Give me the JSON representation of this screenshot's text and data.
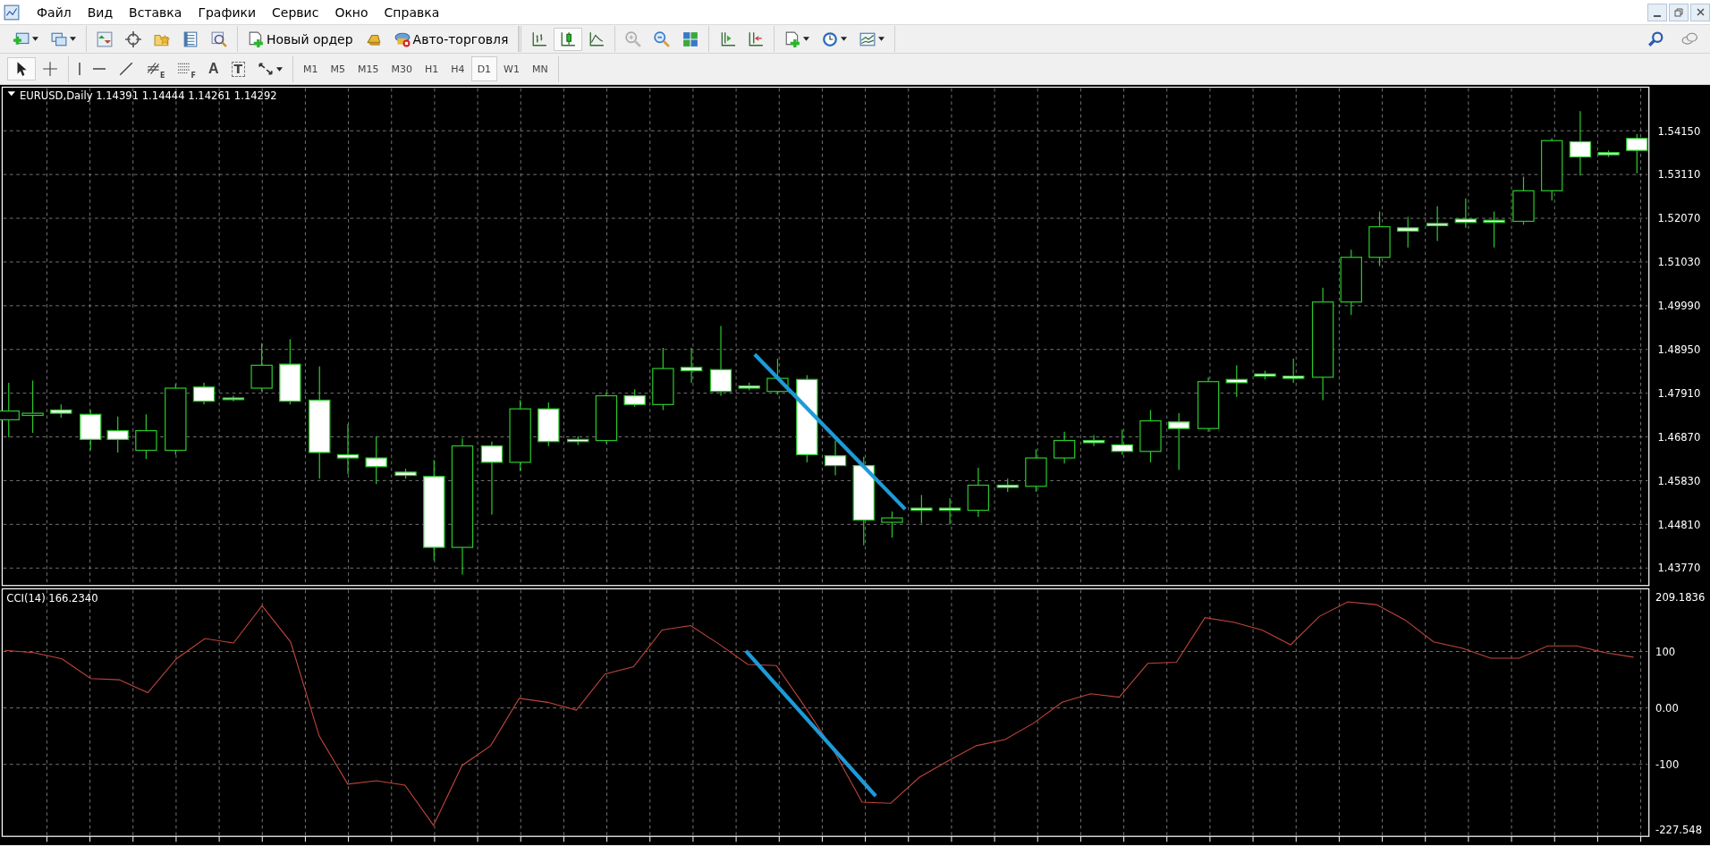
{
  "menu": [
    "Файл",
    "Вид",
    "Вставка",
    "Графики",
    "Сервис",
    "Окно",
    "Справка"
  ],
  "toolbar": {
    "order_button": "Новый ордер",
    "autotrading_button": "Авто-торговля",
    "chart_types": [
      {
        "kind": "bars",
        "selected": false
      },
      {
        "kind": "candles",
        "selected": true
      },
      {
        "kind": "line",
        "selected": false
      }
    ]
  },
  "drawing_tools": [
    {
      "kind": "cursor",
      "selected": true
    },
    {
      "kind": "crosshair",
      "selected": false
    },
    {
      "kind": "vline",
      "selected": false
    },
    {
      "kind": "hline",
      "selected": false
    },
    {
      "kind": "trendline",
      "selected": false
    },
    {
      "kind": "fibo-channel",
      "label": "E",
      "selected": false
    },
    {
      "kind": "fibo",
      "label": "F",
      "selected": false
    },
    {
      "kind": "text",
      "label": "A",
      "selected": false
    },
    {
      "kind": "label",
      "label": "T",
      "selected": false
    },
    {
      "kind": "arrows",
      "selected": false
    }
  ],
  "timeframes": [
    {
      "label": "M1",
      "selected": false
    },
    {
      "label": "M5",
      "selected": false
    },
    {
      "label": "M15",
      "selected": false
    },
    {
      "label": "M30",
      "selected": false
    },
    {
      "label": "H1",
      "selected": false
    },
    {
      "label": "H4",
      "selected": false
    },
    {
      "label": "D1",
      "selected": true
    },
    {
      "label": "W1",
      "selected": false
    },
    {
      "label": "MN",
      "selected": false
    }
  ],
  "chart": {
    "header": "EURUSD,Daily  1.14391 1.14444 1.14261 1.14292",
    "price_labels": [
      "1.54150",
      "1.53110",
      "1.52070",
      "1.51030",
      "1.49990",
      "1.48950",
      "1.47910",
      "1.46870",
      "1.45830",
      "1.44810",
      "1.43770"
    ],
    "indicator": {
      "current_value": "166.2340",
      "chart_data": {
        "type": "line",
        "ylim": [
          -227.548,
          209.1836
        ],
        "yticks": [
          {
            "value": 209.1836,
            "label": "209.1836"
          },
          100,
          {
            "value": 0,
            "label": "0.00"
          },
          -100,
          {
            "value": -227.548,
            "label": "-227.548"
          }
        ],
        "series": [
          {
            "name": "CCI(14)",
            "color": "#c0453a",
            "values": [
              102,
              98,
              87,
              52,
              50,
              27,
              87,
              123,
              115,
              181,
              117,
              -50,
              -135,
              -129,
              -137,
              -208,
              -102,
              -67,
              17,
              10,
              -4,
              60,
              73,
              138,
              146,
              113,
              77,
              75,
              2,
              -75,
              -167,
              -169,
              -123,
              -94,
              -67,
              -56,
              -27,
              10,
              25,
              19,
              79,
              81,
              160,
              152,
              138,
              112,
              162,
              188,
              183,
              156,
              117,
              106,
              88,
              88,
              110,
              110,
              98,
              90
            ]
          }
        ]
      }
    }
  }
}
